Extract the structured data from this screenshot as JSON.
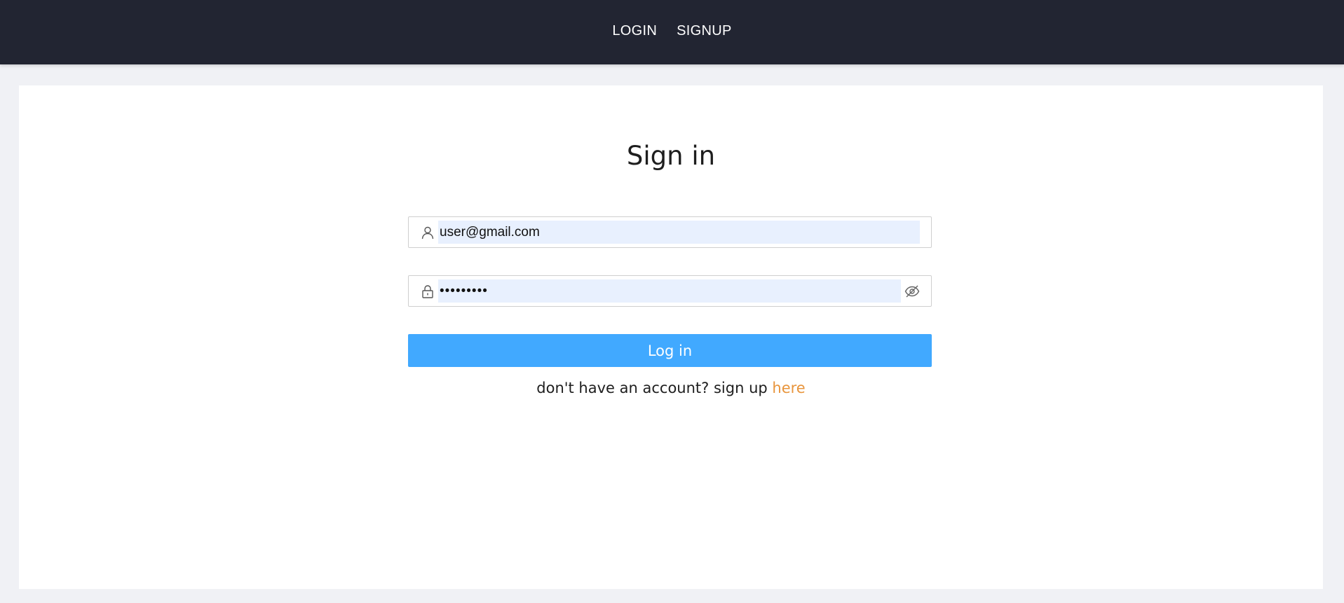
{
  "nav": {
    "login_label": "LOGIN",
    "signup_label": "SIGNUP"
  },
  "form": {
    "title": "Sign in",
    "email_value": "user@gmail.com",
    "password_value": "•••••••••",
    "login_button_label": "Log in",
    "signup_prompt": "don't have an account? sign up",
    "signup_link_label": "here"
  },
  "icons": {
    "email": "user-icon",
    "password": "lock-icon",
    "toggle": "eye-off-icon"
  },
  "colors": {
    "topbar": "#222532",
    "page_background": "#f0f1f5",
    "button": "#41a9ff",
    "link": "#e8953c",
    "autofill": "#e8f0fe"
  }
}
